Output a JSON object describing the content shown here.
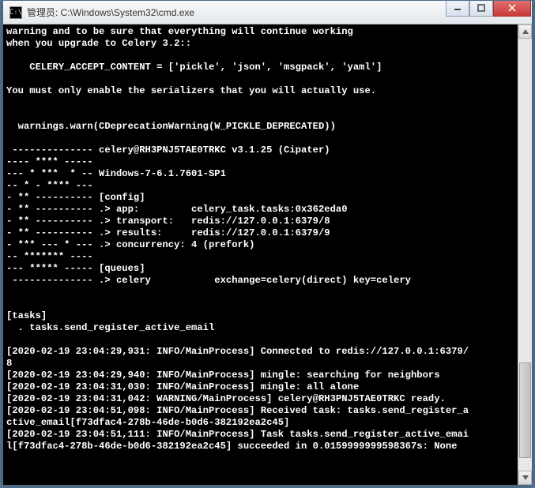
{
  "window": {
    "icon_text": "C:\\",
    "title": "管理员: C:\\Windows\\System32\\cmd.exe"
  },
  "terminal_lines": [
    "warning and to be sure that everything will continue working",
    "when you upgrade to Celery 3.2::",
    "",
    "    CELERY_ACCEPT_CONTENT = ['pickle', 'json', 'msgpack', 'yaml']",
    "",
    "You must only enable the serializers that you will actually use.",
    "",
    "",
    "  warnings.warn(CDeprecationWarning(W_PICKLE_DEPRECATED))",
    "",
    " -------------- celery@RH3PNJ5TAE0TRKC v3.1.25 (Cipater)",
    "---- **** -----",
    "--- * ***  * -- Windows-7-6.1.7601-SP1",
    "-- * - **** ---",
    "- ** ---------- [config]",
    "- ** ---------- .> app:         celery_task.tasks:0x362eda0",
    "- ** ---------- .> transport:   redis://127.0.0.1:6379/8",
    "- ** ---------- .> results:     redis://127.0.0.1:6379/9",
    "- *** --- * --- .> concurrency: 4 (prefork)",
    "-- ******* ----",
    "--- ***** ----- [queues]",
    " -------------- .> celery           exchange=celery(direct) key=celery",
    "",
    "",
    "[tasks]",
    "  . tasks.send_register_active_email",
    "",
    "[2020-02-19 23:04:29,931: INFO/MainProcess] Connected to redis://127.0.0.1:6379/",
    "8",
    "[2020-02-19 23:04:29,940: INFO/MainProcess] mingle: searching for neighbors",
    "[2020-02-19 23:04:31,030: INFO/MainProcess] mingle: all alone",
    "[2020-02-19 23:04:31,042: WARNING/MainProcess] celery@RH3PNJ5TAE0TRKC ready.",
    "[2020-02-19 23:04:51,098: INFO/MainProcess] Received task: tasks.send_register_a",
    "ctive_email[f73dfac4-278b-46de-b0d6-382192ea2c45]",
    "[2020-02-19 23:04:51,111: INFO/MainProcess] Task tasks.send_register_active_emai",
    "l[f73dfac4-278b-46de-b0d6-382192ea2c45] succeeded in 0.0159999999598367s: None"
  ]
}
